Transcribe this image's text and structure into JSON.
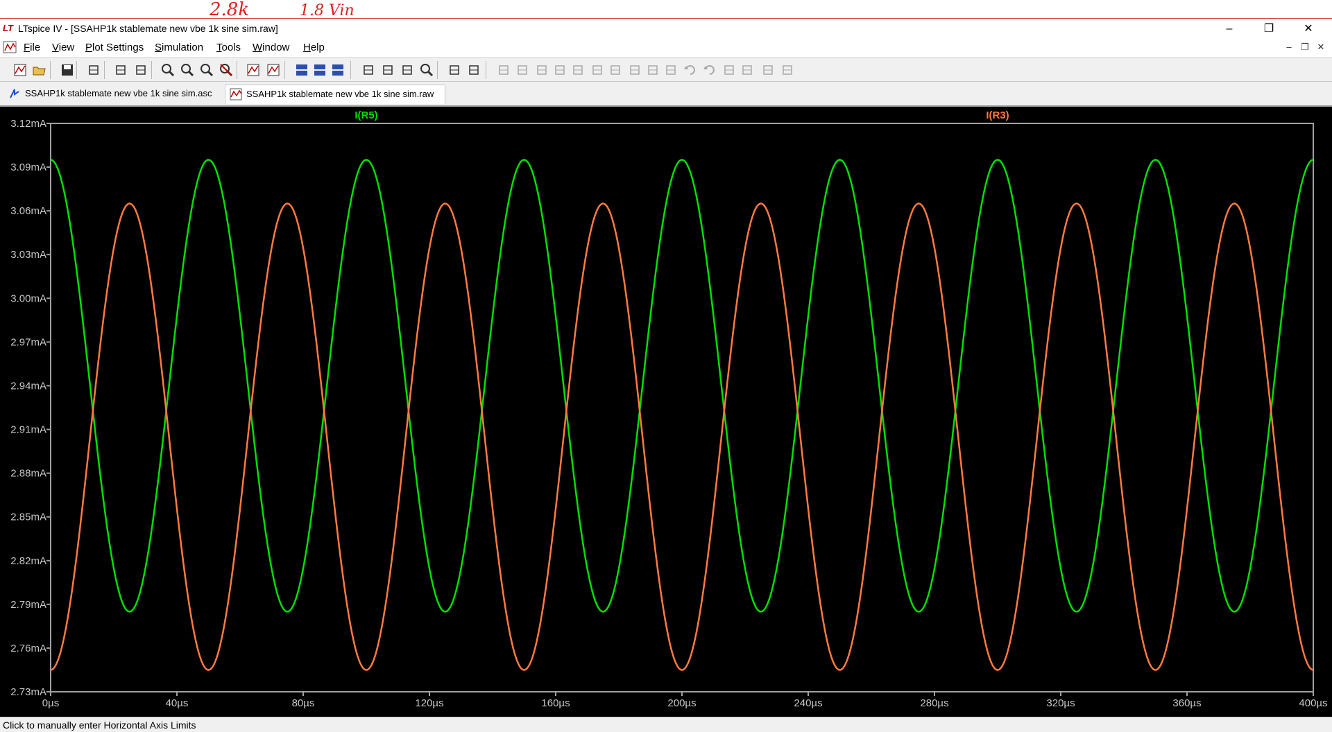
{
  "annotation": {
    "handwritten_1": "2.8k",
    "handwritten_2": "1.8 Vin"
  },
  "window": {
    "title": "LTspice IV - [SSAHP1k stablemate new vbe 1k sine sim.raw]",
    "app_icon": "LT"
  },
  "menu": {
    "items": [
      {
        "label": "File",
        "key": "F",
        "rest": "ile"
      },
      {
        "label": "View",
        "key": "V",
        "rest": "iew"
      },
      {
        "label": "Plot Settings",
        "key": "P",
        "rest": "lot Settings"
      },
      {
        "label": "Simulation",
        "key": "S",
        "rest": "imulation"
      },
      {
        "label": "Tools",
        "key": "T",
        "rest": "ools"
      },
      {
        "label": "Window",
        "key": "W",
        "rest": "indow"
      },
      {
        "label": "Help",
        "key": "H",
        "rest": "elp"
      }
    ]
  },
  "tabs": [
    {
      "label": "SSAHP1k stablemate new vbe 1k sine sim.asc",
      "icon": "schematic-icon",
      "active": false
    },
    {
      "label": "SSAHP1k stablemate new vbe 1k sine sim.raw",
      "icon": "waveform-icon",
      "active": true
    }
  ],
  "toolbar": {
    "icons": [
      "new-schematic-icon",
      "open-icon",
      "save-icon",
      "control-panel-icon",
      "run-icon",
      "halt-icon",
      "zoom-in-icon",
      "zoom-fit-icon",
      "zoom-out-icon",
      "zoom-cancel-icon",
      "autorange-icon",
      "mark-unused-icon",
      "tile-horizontal-icon",
      "cascade-icon",
      "tile-vertical-icon",
      "cut-icon",
      "copy-icon",
      "paste-icon",
      "find-icon",
      "print-icon",
      "print-preview-icon",
      "draw-wire-icon",
      "ground-icon",
      "label-net-icon",
      "resistor-icon",
      "capacitor-icon",
      "inductor-icon",
      "diode-icon",
      "component-icon",
      "move-icon",
      "drag-icon",
      "undo-icon",
      "redo-icon",
      "rotate-icon",
      "mirror-icon",
      "text-icon",
      "spice-directive-icon"
    ]
  },
  "colors": {
    "plot_bg": "#000000",
    "grid": "#a0a0a0",
    "trace_r5": "#00e000",
    "trace_r3": "#ff7a40",
    "axis_text": "#c8c8c8"
  },
  "status": {
    "text": "Click to manually enter Horizontal Axis Limits"
  },
  "chart_data": {
    "type": "line",
    "title": "",
    "xlabel": "",
    "ylabel": "",
    "x_ticks": [
      "0µs",
      "40µs",
      "80µs",
      "120µs",
      "160µs",
      "200µs",
      "240µs",
      "280µs",
      "320µs",
      "360µs",
      "400µs"
    ],
    "y_ticks": [
      "3.12mA",
      "3.09mA",
      "3.06mA",
      "3.03mA",
      "3.00mA",
      "2.97mA",
      "2.94mA",
      "2.91mA",
      "2.88mA",
      "2.85mA",
      "2.82mA",
      "2.79mA",
      "2.76mA",
      "2.73mA"
    ],
    "xlim_us": [
      0,
      400
    ],
    "ylim_mA": [
      2.73,
      3.12
    ],
    "grid": false,
    "series": [
      {
        "name": "I(R5)",
        "kind": "sine",
        "offset_mA": 2.94,
        "amplitude_mA": 0.155,
        "period_us": 50,
        "phase": "cos",
        "x_start_us": 0,
        "x_end_us": 400
      },
      {
        "name": "I(R3)",
        "kind": "sine",
        "offset_mA": 2.905,
        "amplitude_mA": 0.16,
        "period_us": 50,
        "phase": "-cos",
        "x_start_us": 0,
        "x_end_us": 400
      }
    ]
  }
}
